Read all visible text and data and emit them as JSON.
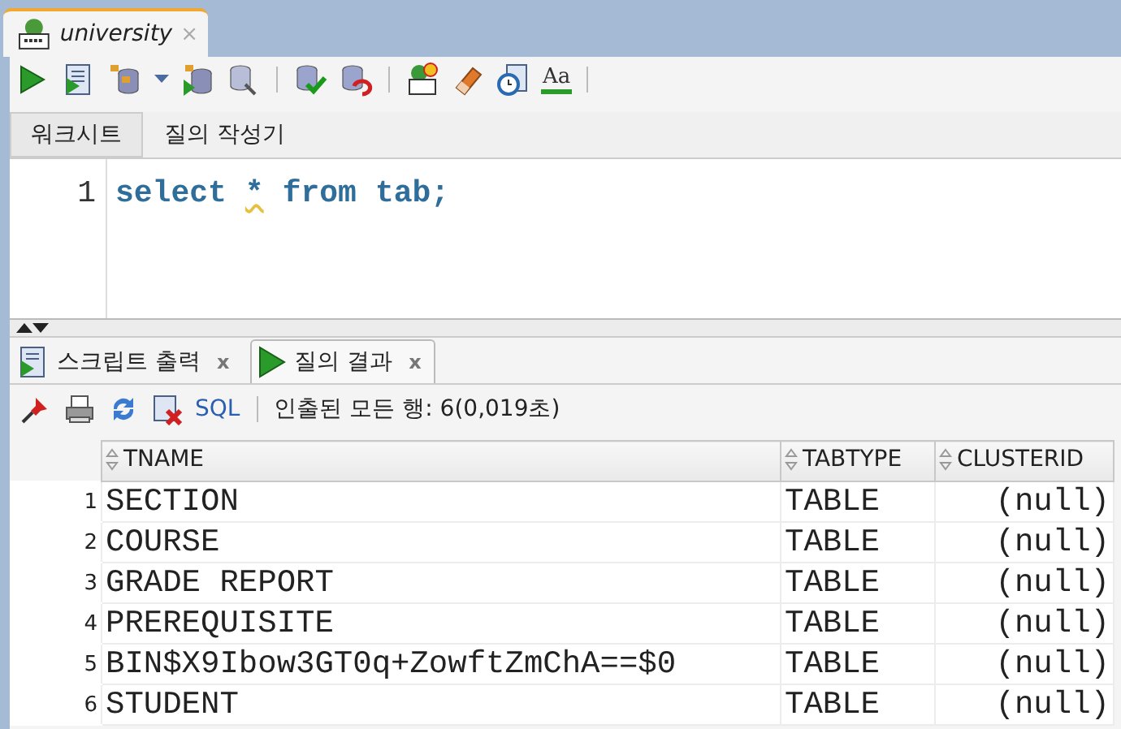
{
  "document_tab": {
    "title": "university",
    "selected": true,
    "close": "×"
  },
  "toolbar": {
    "case_label": "Aa"
  },
  "editor_tabs": [
    {
      "label": "워크시트",
      "selected": true
    },
    {
      "label": "질의 작성기",
      "selected": false
    }
  ],
  "editor": {
    "lines": [
      {
        "number": "1",
        "tokens": [
          {
            "text": "select",
            "flagged": false
          },
          {
            "text": "*",
            "flagged": true
          },
          {
            "text": "from",
            "flagged": false
          },
          {
            "text": "tab;",
            "flagged": false
          }
        ]
      }
    ]
  },
  "result_tabs": [
    {
      "label": "스크립트 출력",
      "selected": false,
      "kind": "script",
      "close": "x"
    },
    {
      "label": "질의 결과",
      "selected": true,
      "kind": "query",
      "close": "x"
    }
  ],
  "result_toolbar": {
    "sql_link": "SQL",
    "status": "인출된 모든 행: 6(0,019초)"
  },
  "table": {
    "columns": [
      "TNAME",
      "TABTYPE",
      "CLUSTERID"
    ],
    "rows": [
      {
        "number": "1",
        "cells": [
          "SECTION",
          "TABLE",
          "(null)"
        ]
      },
      {
        "number": "2",
        "cells": [
          "COURSE",
          "TABLE",
          "(null)"
        ]
      },
      {
        "number": "3",
        "cells": [
          "GRADE REPORT",
          "TABLE",
          "(null)"
        ]
      },
      {
        "number": "4",
        "cells": [
          "PREREQUISITE",
          "TABLE",
          "(null)"
        ]
      },
      {
        "number": "5",
        "cells": [
          "BIN$X9Ibow3GT0q+ZowftZmChA==$0",
          "TABLE",
          "(null)"
        ]
      },
      {
        "number": "6",
        "cells": [
          "STUDENT",
          "TABLE",
          "(null)"
        ]
      }
    ]
  }
}
